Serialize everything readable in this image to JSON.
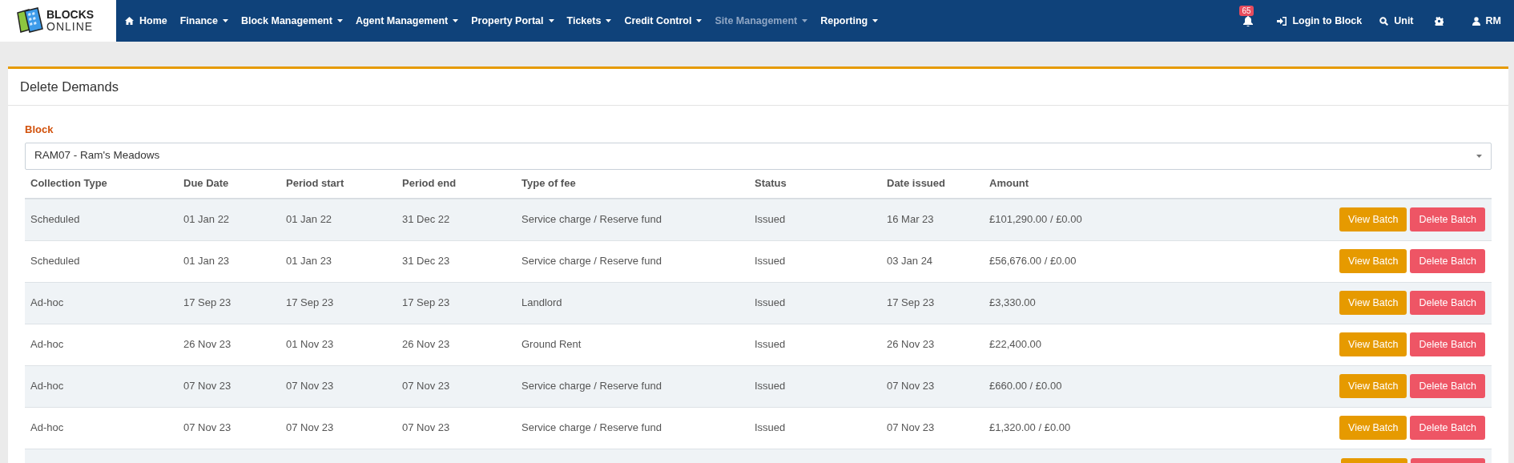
{
  "logo": {
    "line1": "BLOCKS",
    "line2": "ONLINE"
  },
  "nav": [
    {
      "label": "Home",
      "kind": "home",
      "disabled": false
    },
    {
      "label": "Finance",
      "kind": "menu",
      "disabled": false
    },
    {
      "label": "Block Management",
      "kind": "menu",
      "disabled": false
    },
    {
      "label": "Agent Management",
      "kind": "menu",
      "disabled": false
    },
    {
      "label": "Property Portal",
      "kind": "menu",
      "disabled": false
    },
    {
      "label": "Tickets",
      "kind": "menu",
      "disabled": false
    },
    {
      "label": "Credit Control",
      "kind": "menu",
      "disabled": false
    },
    {
      "label": "Site Management",
      "kind": "menu",
      "disabled": true
    },
    {
      "label": "Reporting",
      "kind": "menu",
      "disabled": false
    }
  ],
  "nav_right": {
    "notifications": "65",
    "login": "Login to Block",
    "search": "Unit",
    "user": "RM"
  },
  "panel": {
    "title": "Delete Demands",
    "block_label": "Block",
    "block_value": "RAM07 - Ram's Meadows"
  },
  "table": {
    "columns": [
      "Collection Type",
      "Due Date",
      "Period start",
      "Period end",
      "Type of fee",
      "Status",
      "Date issued",
      "Amount"
    ],
    "rows": [
      {
        "cells": [
          "Scheduled",
          "01 Jan 22",
          "01 Jan 22",
          "31 Dec 22",
          "Service charge / Reserve fund",
          "Issued",
          "16 Mar 23",
          "£101,290.00 / £0.00"
        ],
        "view": "View Batch",
        "delete": "Delete Batch"
      },
      {
        "cells": [
          "Scheduled",
          "01 Jan 23",
          "01 Jan 23",
          "31 Dec 23",
          "Service charge / Reserve fund",
          "Issued",
          "03 Jan 24",
          "£56,676.00 / £0.00"
        ],
        "view": "View Batch",
        "delete": "Delete Batch"
      },
      {
        "cells": [
          "Ad-hoc",
          "17 Sep 23",
          "17 Sep 23",
          "17 Sep 23",
          "Landlord",
          "Issued",
          "17 Sep 23",
          "£3,330.00"
        ],
        "view": "View Batch",
        "delete": "Delete Batch"
      },
      {
        "cells": [
          "Ad-hoc",
          "26 Nov 23",
          "01 Nov 23",
          "26 Nov 23",
          "Ground Rent",
          "Issued",
          "26 Nov 23",
          "£22,400.00"
        ],
        "view": "View Batch",
        "delete": "Delete Batch"
      },
      {
        "cells": [
          "Ad-hoc",
          "07 Nov 23",
          "07 Nov 23",
          "07 Nov 23",
          "Service charge / Reserve fund",
          "Issued",
          "07 Nov 23",
          "£660.00 / £0.00"
        ],
        "view": "View Batch",
        "delete": "Delete Batch"
      },
      {
        "cells": [
          "Ad-hoc",
          "07 Nov 23",
          "07 Nov 23",
          "07 Nov 23",
          "Service charge / Reserve fund",
          "Issued",
          "07 Nov 23",
          "£1,320.00 / £0.00"
        ],
        "view": "View Batch",
        "delete": "Delete Batch"
      }
    ],
    "partial_row": true
  }
}
